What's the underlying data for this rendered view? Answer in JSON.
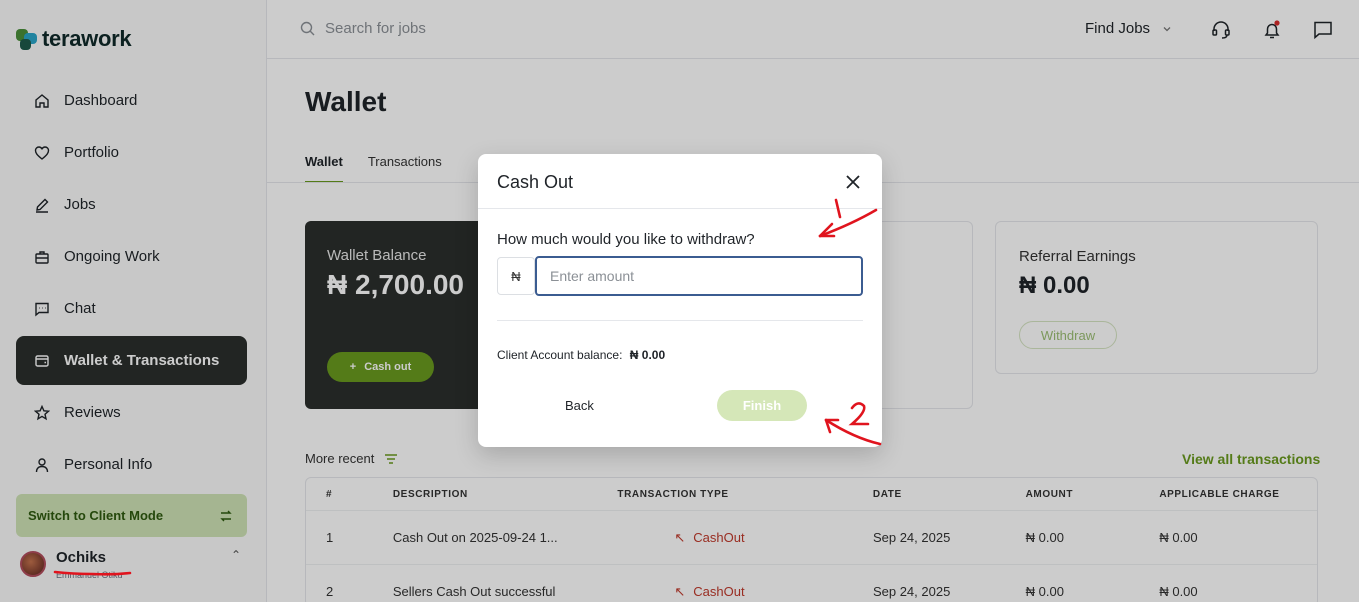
{
  "brand": {
    "name": "terawork"
  },
  "search": {
    "placeholder": "Search for jobs"
  },
  "topbar": {
    "find_jobs": "Find Jobs"
  },
  "sidebar": {
    "items": [
      {
        "label": "Dashboard",
        "icon": "home-icon"
      },
      {
        "label": "Portfolio",
        "icon": "heart-icon"
      },
      {
        "label": "Jobs",
        "icon": "pencil-icon"
      },
      {
        "label": "Ongoing Work",
        "icon": "briefcase-icon"
      },
      {
        "label": "Chat",
        "icon": "chat-icon"
      },
      {
        "label": "Wallet & Transactions",
        "icon": "wallet-icon",
        "active": true
      },
      {
        "label": "Reviews",
        "icon": "star-icon"
      },
      {
        "label": "Personal Info",
        "icon": "user-icon"
      }
    ],
    "switch_mode": "Switch to Client Mode",
    "user": {
      "name": "Ochiks",
      "subtitle": "Emmanuel Otiku"
    }
  },
  "page": {
    "title": "Wallet",
    "tabs": [
      "Wallet",
      "Transactions"
    ]
  },
  "wallet_card": {
    "label": "Wallet Balance",
    "amount": "₦ 2,700.00",
    "cashout": "Cash out"
  },
  "referral_card": {
    "label": "Referral Earnings",
    "amount": "₦ 0.00",
    "withdraw": "Withdraw"
  },
  "transactions": {
    "more_recent": "More recent",
    "view_all": "View all transactions",
    "headers": [
      "#",
      "DESCRIPTION",
      "TRANSACTION TYPE",
      "DATE",
      "AMOUNT",
      "APPLICABLE CHARGE"
    ],
    "rows": [
      {
        "num": "1",
        "description": "Cash Out on 2025-09-24 1...",
        "type": "CashOut",
        "date": "Sep 24, 2025",
        "amount": "₦ 0.00",
        "charge": "₦ 0.00"
      },
      {
        "num": "2",
        "description": "Sellers Cash Out successful",
        "type": "CashOut",
        "date": "Sep 24, 2025",
        "amount": "₦ 0.00",
        "charge": "₦ 0.00"
      }
    ]
  },
  "modal": {
    "title": "Cash Out",
    "question": "How much would you like to withdraw?",
    "currency": "₦",
    "amount_placeholder": "Enter amount",
    "balance_label": "Client Account balance:",
    "balance_value": "₦ 0.00",
    "back": "Back",
    "finish": "Finish"
  },
  "annotations": {
    "marker_1": "1",
    "marker_2": "2"
  },
  "colors": {
    "accent": "#6a9a1f",
    "dark": "#2b2f2c",
    "annotation": "#e0141e"
  }
}
